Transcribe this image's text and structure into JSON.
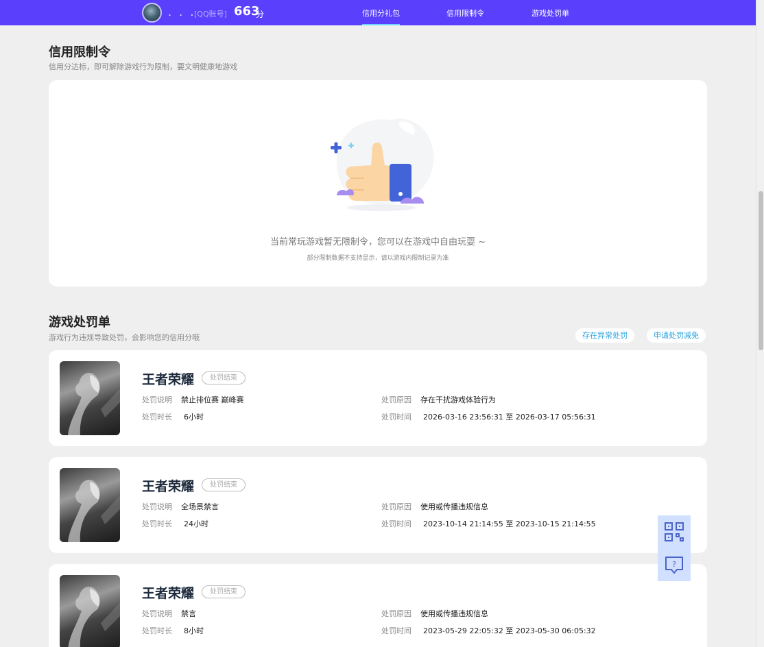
{
  "header": {
    "nickname": ". . .",
    "account_label": "[QQ账号]",
    "score": "663",
    "score_unit": "分",
    "nav": [
      {
        "label": "信用分礼包",
        "active": true
      },
      {
        "label": "信用限制令",
        "active": false
      },
      {
        "label": "游戏处罚单",
        "active": false
      }
    ]
  },
  "restrictions": {
    "title": "信用限制令",
    "subtitle": "信用分达标，即可解除游戏行为限制，要文明健康地游戏",
    "empty_message": "当前常玩游戏暂无限制令，您可以在游戏中自由玩耍 ~",
    "empty_hint": "部分限制数据不支持显示，请以游戏内限制记录为准"
  },
  "penalties": {
    "title": "游戏处罚单",
    "subtitle": "游戏行为违规导致处罚，会影响您的信用分哦",
    "btn_abnormal": "存在异常处罚",
    "btn_appeal": "申请处罚减免",
    "labels": {
      "desc": "处罚说明",
      "duration": "处罚时长",
      "reason": "处罚原因",
      "time": "处罚时间"
    },
    "items": [
      {
        "game": "王者荣耀",
        "status": "处罚结束",
        "desc": "禁止排位赛 巅峰赛",
        "duration": "6小时",
        "reason": "存在干扰游戏体验行为",
        "time": "2026-03-16 23:56:31 至 2026-03-17 05:56:31"
      },
      {
        "game": "王者荣耀",
        "status": "处罚结束",
        "desc": "全场景禁言",
        "duration": "24小时",
        "reason": "使用或传播违规信息",
        "time": "2023-10-14 21:14:55 至 2023-10-15 21:14:55"
      },
      {
        "game": "王者荣耀",
        "status": "处罚结束",
        "desc": "禁言",
        "duration": "8小时",
        "reason": "使用或传播违规信息",
        "time": "2023-05-29 22:05:32 至 2023-05-30 06:05:32"
      }
    ]
  },
  "icons": {
    "qr": "qr-code-icon",
    "feedback": "help-chat-icon"
  },
  "colors": {
    "header_bg": "#5a3ffc",
    "accent": "#2aa3e0",
    "page_bg": "#efefef"
  }
}
